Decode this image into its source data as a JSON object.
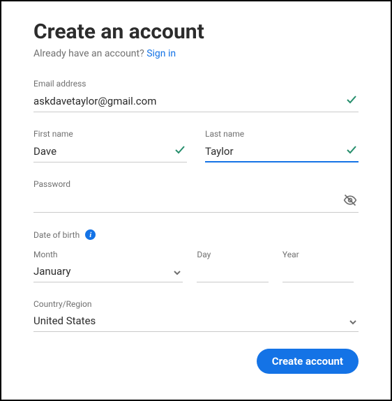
{
  "title": "Create an account",
  "already_text": "Already have an account? ",
  "signin_label": "Sign in",
  "email": {
    "label": "Email address",
    "value": "askdavetaylor@gmail.com"
  },
  "first_name": {
    "label": "First name",
    "value": "Dave"
  },
  "last_name": {
    "label": "Last name",
    "value": "Taylor"
  },
  "password": {
    "label": "Password",
    "value": ""
  },
  "dob": {
    "section_label": "Date of birth",
    "month_label": "Month",
    "month_value": "January",
    "day_label": "Day",
    "day_value": "",
    "year_label": "Year",
    "year_value": ""
  },
  "country": {
    "label": "Country/Region",
    "value": "United States"
  },
  "create_button": "Create account"
}
